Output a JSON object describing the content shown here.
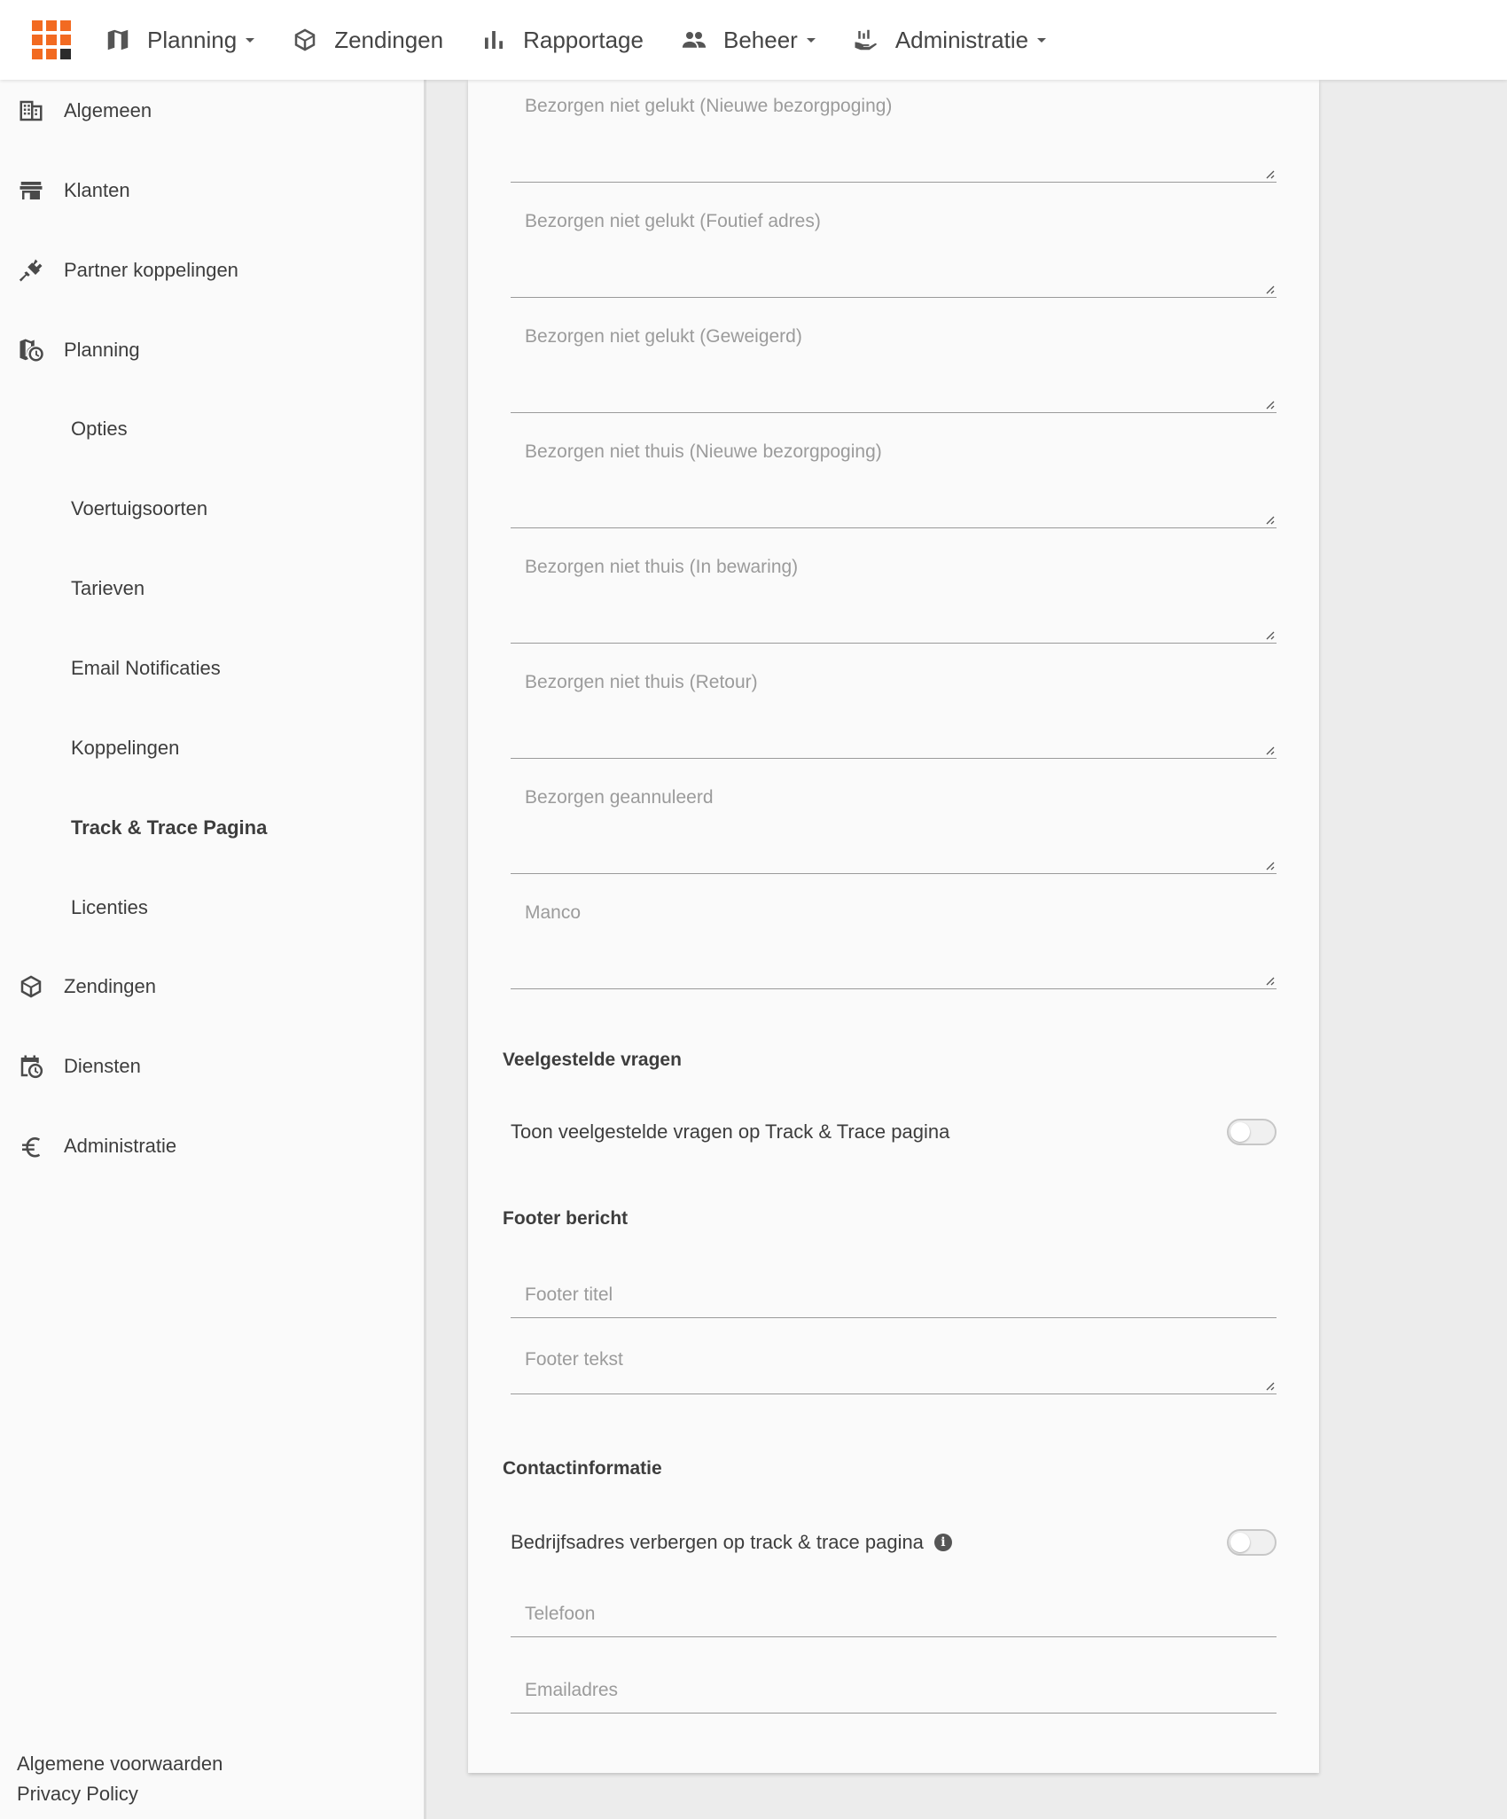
{
  "topnav": {
    "items": [
      {
        "label": "Planning",
        "icon": "map-icon",
        "dropdown": true
      },
      {
        "label": "Zendingen",
        "icon": "package-icon",
        "dropdown": false
      },
      {
        "label": "Rapportage",
        "icon": "bar-chart-icon",
        "dropdown": false
      },
      {
        "label": "Beheer",
        "icon": "users-icon",
        "dropdown": true
      },
      {
        "label": "Administratie",
        "icon": "chart-hand-icon",
        "dropdown": true
      }
    ]
  },
  "sidebar": {
    "items": [
      {
        "label": "Algemeen",
        "icon": "building-icon"
      },
      {
        "label": "Klanten",
        "icon": "store-icon"
      },
      {
        "label": "Partner koppelingen",
        "icon": "plug-icon"
      },
      {
        "label": "Planning",
        "icon": "map-clock-icon"
      }
    ],
    "subitems": [
      "Opties",
      "Voertuigsoorten",
      "Tarieven",
      "Email Notificaties",
      "Koppelingen",
      "Track & Trace Pagina",
      "Licenties"
    ],
    "active_subitem": "Track & Trace Pagina",
    "items_after": [
      {
        "label": "Zendingen",
        "icon": "package-icon"
      },
      {
        "label": "Diensten",
        "icon": "calendar-clock-icon"
      },
      {
        "label": "Administratie",
        "icon": "euro-icon"
      }
    ],
    "footer_links": [
      "Algemene voorwaarden",
      "Privacy Policy"
    ]
  },
  "form": {
    "status_fields": [
      {
        "placeholder": "Bezorgen niet gelukt (Nieuwe bezorgpoging)",
        "value": ""
      },
      {
        "placeholder": "Bezorgen niet gelukt (Foutief adres)",
        "value": ""
      },
      {
        "placeholder": "Bezorgen niet gelukt (Geweigerd)",
        "value": ""
      },
      {
        "placeholder": "Bezorgen niet thuis (Nieuwe bezorgpoging)",
        "value": ""
      },
      {
        "placeholder": "Bezorgen niet thuis (In bewaring)",
        "value": ""
      },
      {
        "placeholder": "Bezorgen niet thuis (Retour)",
        "value": ""
      },
      {
        "placeholder": "Bezorgen geannuleerd",
        "value": ""
      },
      {
        "placeholder": "Manco",
        "value": ""
      }
    ],
    "faq": {
      "title": "Veelgestelde vragen",
      "toggle_label": "Toon veelgestelde vragen op Track & Trace pagina",
      "toggle_on": false
    },
    "footer": {
      "title": "Footer bericht",
      "title_field_placeholder": "Footer titel",
      "text_field_placeholder": "Footer tekst"
    },
    "contact": {
      "title": "Contactinformatie",
      "toggle_label": "Bedrijfsadres verbergen op track & trace pagina",
      "toggle_on": false,
      "phone_placeholder": "Telefoon",
      "email_placeholder": "Emailadres"
    }
  }
}
